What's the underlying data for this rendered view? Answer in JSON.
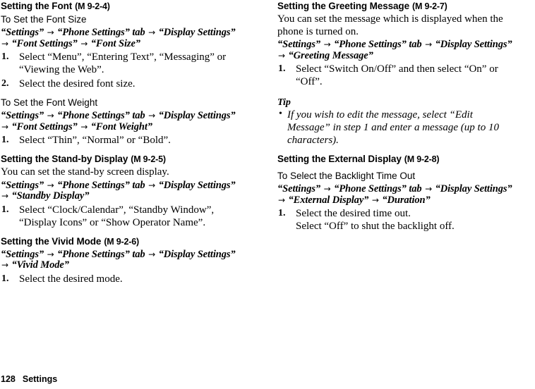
{
  "page": {
    "number": "128",
    "chapter": "Settings"
  },
  "left_column": {
    "sections": [
      {
        "heading": "Setting the Font",
        "code": "(M 9-2-4)",
        "sub_heading_1": "To Set the Font Size",
        "navpath_1": {
          "part1": "“Settings”",
          "arrow1": "→",
          "part2": "“Phone Settings” tab",
          "arrow2": "→",
          "part3": "“Display Settings”",
          "arrow3": "→",
          "part4": "“Font Settings”",
          "arrow4": "→",
          "part5": "“Font Size”"
        },
        "step_1_num": "1.",
        "step_1_text": "Select “Menu”, “Entering Text”, “Messaging” or “Viewing the Web”.",
        "step_2_num": "2.",
        "step_2_text": "Select the desired font size.",
        "sub_heading_2": "To Set the Font Weight",
        "navpath_2": {
          "part1": "“Settings”",
          "arrow1": "→",
          "part2": "“Phone Settings” tab",
          "arrow2": "→",
          "part3": "“Display Settings”",
          "arrow3": "→",
          "part4": "“Font Settings”",
          "arrow4": "→",
          "part5": "“Font Weight”"
        },
        "step_3_num": "1.",
        "step_3_text": "Select “Thin”, “Normal” or “Bold”."
      },
      {
        "heading": "Setting the Stand-by Display",
        "code": "(M 9-2-5)",
        "intro": "You can set the stand-by screen display.",
        "navpath": {
          "part1": "“Settings”",
          "arrow1": "→",
          "part2": "“Phone Settings” tab",
          "arrow2": "→",
          "part3": "“Display Settings”",
          "arrow3": "→",
          "part4": "“Standby Display”"
        },
        "step_1_num": "1.",
        "step_1_text": "Select “Clock/Calendar”, “Standby Window”, “Display Icons” or “Show Operator Name”."
      },
      {
        "heading": "Setting the Vivid Mode",
        "code": "(M 9-2-6)",
        "navpath": {
          "part1": "“Settings”",
          "arrow1": "→",
          "part2": "“Phone Settings” tab",
          "arrow2": "→",
          "part3": "“Display Settings”",
          "arrow3": "→",
          "part4": "“Vivid Mode”"
        },
        "step_1_num": "1.",
        "step_1_text": "Select the desired mode."
      }
    ]
  },
  "right_column": {
    "sections": [
      {
        "heading": "Setting the Greeting Message",
        "code": "(M 9-2-7)",
        "intro": "You can set the message which is displayed when the phone is turned on.",
        "navpath": {
          "part1": "“Settings”",
          "arrow1": "→",
          "part2": "“Phone Settings” tab",
          "arrow2": "→",
          "part3": "“Display Settings”",
          "arrow3": "→",
          "part4": "“Greeting Message”"
        },
        "step_1_num": "1.",
        "step_1_text": "Select “Switch On/Off” and then select “On” or “Off”.",
        "tip_heading": "Tip",
        "tip_bullet": "•",
        "tip_text": "If you wish to edit the message, select “Edit Message” in step 1 and enter a message (up to 10 characters)."
      },
      {
        "heading": "Setting the External Display",
        "code": "(M 9-2-8)",
        "sub_heading": "To Select the Backlight Time Out",
        "navpath": {
          "part1": "“Settings”",
          "arrow1": "→",
          "part2": "“Phone Settings” tab",
          "arrow2": "→",
          "part3": "“Display Settings”",
          "arrow3": "→",
          "part4": "“External Display”",
          "arrow4": "→",
          "part5": "“Duration”"
        },
        "step_1_num": "1.",
        "step_1_text": "Select the desired time out.",
        "step_1_cont": "Select “Off” to shut the backlight off."
      }
    ]
  }
}
